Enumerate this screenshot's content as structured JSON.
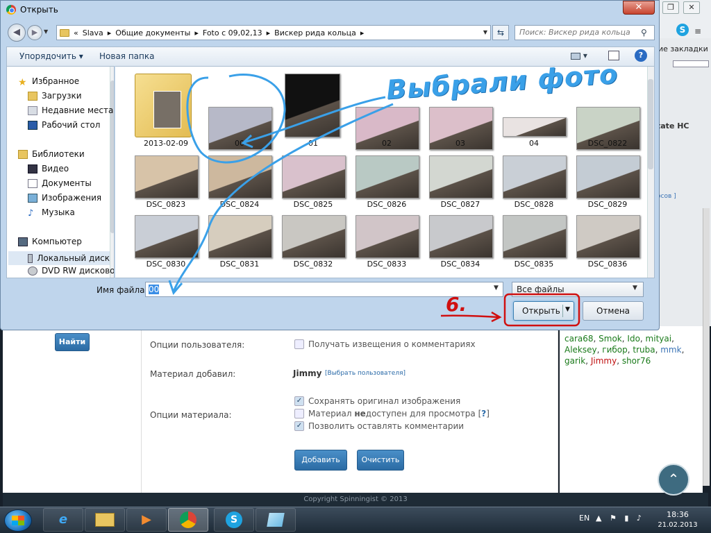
{
  "dialog": {
    "title": "Открыть",
    "close": "✕",
    "address": {
      "chevron": "«",
      "parts": [
        "Slava",
        "Общие документы",
        "Foto с 09,02,13",
        "Вискер рида кольца"
      ],
      "sep": "▸"
    },
    "search_placeholder": "Поиск: Вискер рида кольца",
    "toolbar": {
      "organize": "Упорядочить ▾",
      "new_folder": "Новая папка",
      "view": "▾",
      "help": "?"
    },
    "nav": [
      {
        "label": "Избранное",
        "icon": "star-icon",
        "header": true
      },
      {
        "label": "Загрузки",
        "icon": "downloads-folder-icon"
      },
      {
        "label": "Недавние места",
        "icon": "recent-places-icon"
      },
      {
        "label": "Рабочий стол",
        "icon": "desktop-icon"
      },
      {
        "label": "Библиотеки",
        "icon": "libraries-icon",
        "header": true
      },
      {
        "label": "Видео",
        "icon": "video-library-icon"
      },
      {
        "label": "Документы",
        "icon": "documents-library-icon"
      },
      {
        "label": "Изображения",
        "icon": "pictures-library-icon"
      },
      {
        "label": "Музыка",
        "icon": "music-library-icon"
      },
      {
        "label": "Компьютер",
        "icon": "computer-icon",
        "header": true
      },
      {
        "label": "Локальный диск",
        "icon": "local-disk-icon",
        "selected": true
      },
      {
        "label": "DVD RW дисково",
        "icon": "dvd-drive-icon"
      }
    ],
    "files": [
      {
        "label": "2013-02-09",
        "kind": "folder"
      },
      {
        "label": "00",
        "kind": "photo",
        "tone": "#b7b9c8"
      },
      {
        "label": "01",
        "kind": "photo",
        "tone": "#111111"
      },
      {
        "label": "02",
        "kind": "photo",
        "tone": "#d9b9c8"
      },
      {
        "label": "03",
        "kind": "photo",
        "tone": "#dcbfca"
      },
      {
        "label": "04",
        "kind": "photo",
        "tone": "#e9e3e2"
      },
      {
        "label": "DSC_0822",
        "kind": "photo",
        "tone": "#c9d3c6"
      },
      {
        "label": "DSC_0823",
        "kind": "photo",
        "tone": "#d7c3a8"
      },
      {
        "label": "DSC_0824",
        "kind": "photo",
        "tone": "#cdb89e"
      },
      {
        "label": "DSC_0825",
        "kind": "photo",
        "tone": "#d9c1cc"
      },
      {
        "label": "DSC_0826",
        "kind": "photo",
        "tone": "#b9c9c4"
      },
      {
        "label": "DSC_0827",
        "kind": "photo",
        "tone": "#d3d7d1"
      },
      {
        "label": "DSC_0828",
        "kind": "photo",
        "tone": "#c9cfd6"
      },
      {
        "label": "DSC_0829",
        "kind": "photo",
        "tone": "#c4ccd4"
      },
      {
        "label": "DSC_0830",
        "kind": "photo",
        "tone": "#c9ced6"
      },
      {
        "label": "DSC_0831",
        "kind": "photo",
        "tone": "#d6cdbe"
      },
      {
        "label": "DSC_0832",
        "kind": "photo",
        "tone": "#c9c7c2"
      },
      {
        "label": "DSC_0833",
        "kind": "photo",
        "tone": "#d1c5c8"
      },
      {
        "label": "DSC_0834",
        "kind": "photo",
        "tone": "#c8c9cc"
      },
      {
        "label": "DSC_0835",
        "kind": "photo",
        "tone": "#c3c6c4"
      },
      {
        "label": "DSC_0836",
        "kind": "photo",
        "tone": "#cfcac4"
      }
    ],
    "filename_label": "Имя файла:",
    "filename_value": "00",
    "filter": "Все файлы",
    "open": "Открыть",
    "cancel": "Отмена"
  },
  "annotations": {
    "caption": "Выбрали фото",
    "step": "6.",
    "ink_blue": "#3aa0e8",
    "ink_red": "#d01010"
  },
  "page": {
    "find_button": "Найти",
    "user_options_label": "Опции пользователя:",
    "notify_checkbox": "Получать извещения о комментариях",
    "added_by_label": "Материал добавил:",
    "added_by_name": "Jimmy",
    "choose_user": "Выбрать пользователя",
    "material_options_label": "Опции материала:",
    "opt_keep_original": "Сохранять оригинал изображения",
    "opt_unavailable_prefix": "Материал ",
    "opt_unavailable_bold": "не",
    "opt_unavailable_suffix": "доступен для просмотра",
    "opt_unavailable_help": "?",
    "opt_allow_comments": "Позволить оставлять комментарии",
    "add_button": "Добавить",
    "clear_button": "Очистить",
    "copyright": "Copyright Spinningist © 2013",
    "bookmarks": "ие закладки",
    "partial_hc": "tate HC",
    "partial_sov": "осов ]",
    "users_line1": [
      {
        "t": "cara68",
        "c": "g"
      },
      {
        "t": "Smok",
        "c": "g"
      },
      {
        "t": "Ido",
        "c": "g"
      },
      {
        "t": "mityai",
        "c": "g"
      }
    ],
    "users_line2": [
      {
        "t": "Aleksey",
        "c": "g"
      },
      {
        "t": "гибор",
        "c": "g"
      },
      {
        "t": "truba",
        "c": "g"
      },
      {
        "t": "mmk",
        "c": "b"
      }
    ],
    "users_line3": [
      {
        "t": "garik",
        "c": "g"
      },
      {
        "t": "Jimmy",
        "c": "r"
      },
      {
        "t": "shor76",
        "c": "g"
      }
    ]
  },
  "taskbar": {
    "lang": "EN",
    "time": "18:36",
    "date": "21.02.2013"
  }
}
